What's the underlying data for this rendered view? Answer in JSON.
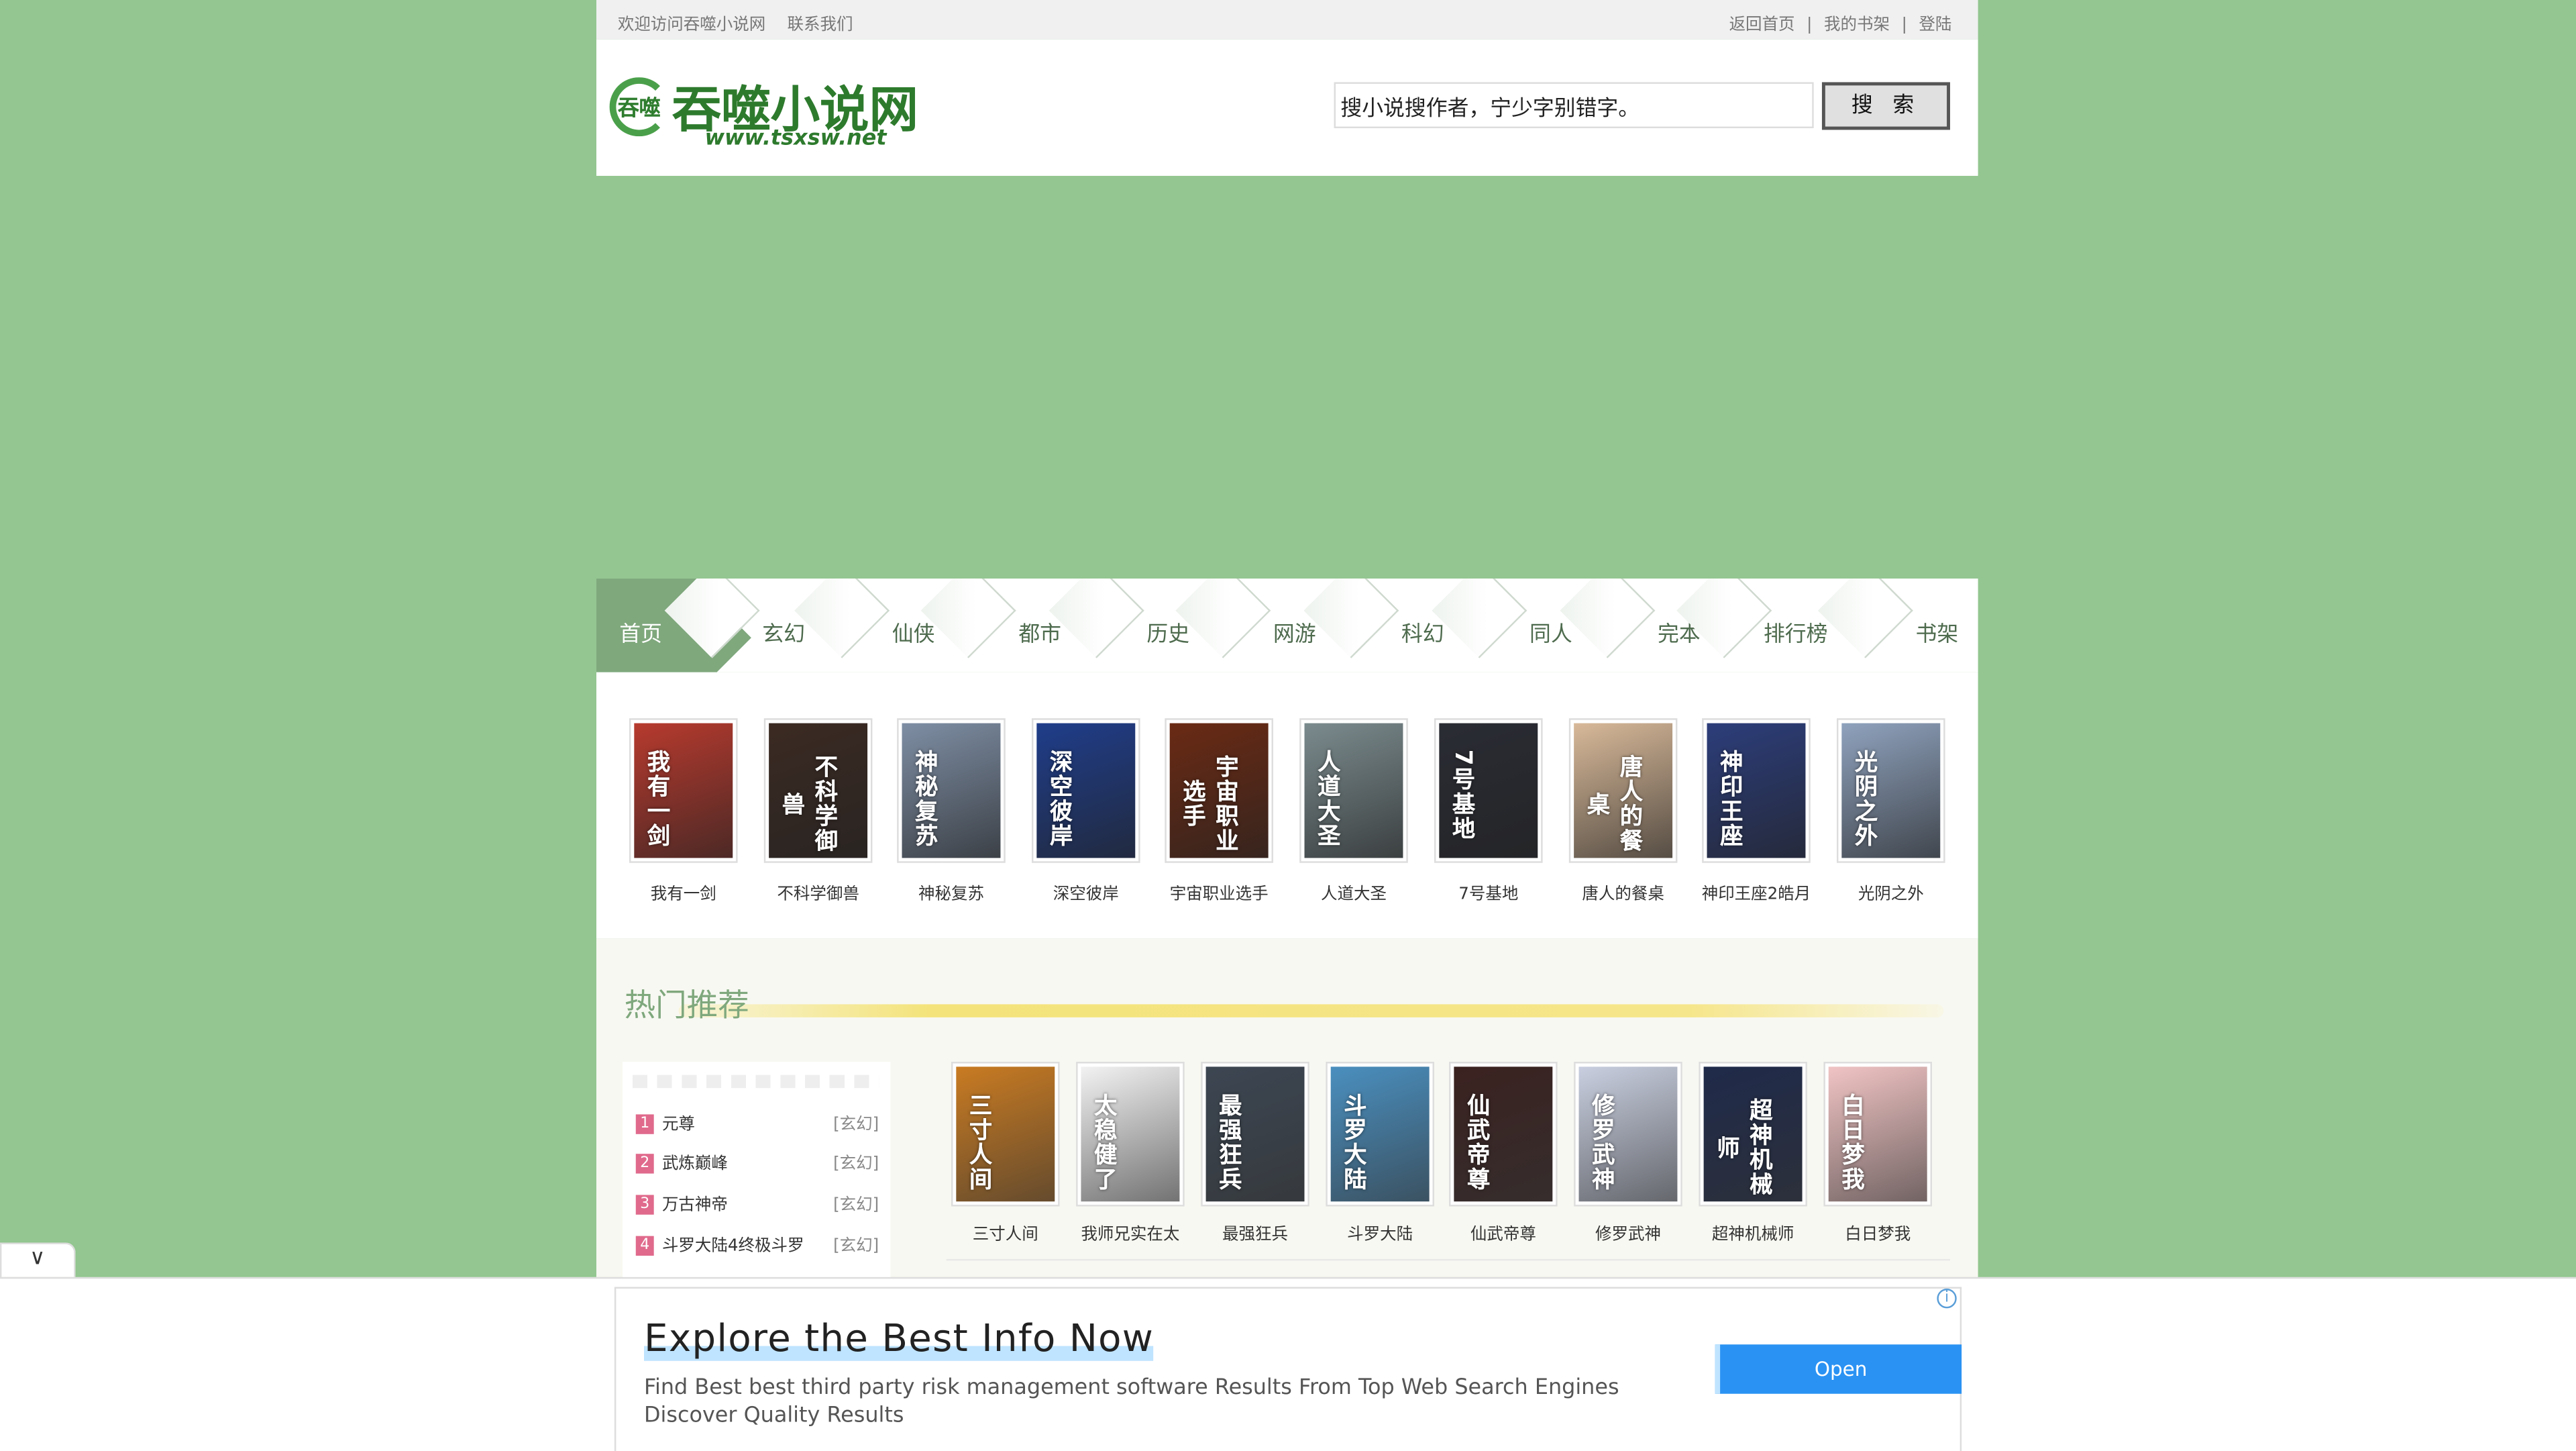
{
  "topbar": {
    "welcome": "欢迎访问吞噬小说网",
    "contact": "联系我们",
    "back_home": "返回首页",
    "my_shelf": "我的书架",
    "login": "登陆",
    "sep": "|"
  },
  "header": {
    "logo_badge": "吞噬",
    "logo_title": "吞噬小说网",
    "logo_url": "www.tsxsw.net",
    "search_placeholder": "搜小说搜作者，宁少字别错字。",
    "search_button": "搜 索"
  },
  "nav": {
    "items": [
      "首页",
      "玄幻",
      "仙侠",
      "都市",
      "历史",
      "网游",
      "科幻",
      "同人",
      "完本",
      "排行榜",
      "书架"
    ]
  },
  "featured": {
    "books": [
      {
        "title": "我有一剑",
        "cover_text": "我有一剑",
        "color": "#b73a2e"
      },
      {
        "title": "不科学御兽",
        "cover_text": "不科学御兽",
        "color": "#3b2a22"
      },
      {
        "title": "神秘复苏",
        "cover_text": "神秘复苏",
        "color": "#7e8ea4"
      },
      {
        "title": "深空彼岸",
        "cover_text": "深空彼岸",
        "color": "#1f3d8a"
      },
      {
        "title": "宇宙职业选手",
        "cover_text": "宇宙职业选手",
        "color": "#6a2a14"
      },
      {
        "title": "人道大圣",
        "cover_text": "人道大圣",
        "color": "#7b8b8e"
      },
      {
        "title": "7号基地",
        "cover_text": "7号基地",
        "color": "#2a2c34"
      },
      {
        "title": "唐人的餐桌",
        "cover_text": "唐人的餐桌",
        "color": "#d8b999"
      },
      {
        "title": "神印王座2皓月",
        "cover_text": "神印王座",
        "color": "#2c3d7a"
      },
      {
        "title": "光阴之外",
        "cover_text": "光阴之外",
        "color": "#8fa2bd"
      }
    ]
  },
  "hot": {
    "title": "热门推荐",
    "ranking": [
      {
        "num": "1",
        "title": "元尊",
        "cat": "[玄幻]"
      },
      {
        "num": "2",
        "title": "武炼巅峰",
        "cat": "[玄幻]"
      },
      {
        "num": "3",
        "title": "万古神帝",
        "cat": "[玄幻]"
      },
      {
        "num": "4",
        "title": "斗罗大陆4终极斗罗",
        "cat": "[玄幻]"
      }
    ],
    "recommend": [
      {
        "title": "三寸人间",
        "cover_text": "三寸人间",
        "color": "#c97b22"
      },
      {
        "title": "我师兄实在太",
        "cover_text": "太稳健了",
        "color": "#f2f2f2"
      },
      {
        "title": "最强狂兵",
        "cover_text": "最强狂兵",
        "color": "#3c4652"
      },
      {
        "title": "斗罗大陆",
        "cover_text": "斗罗大陆",
        "color": "#4a8fbf"
      },
      {
        "title": "仙武帝尊",
        "cover_text": "仙武帝尊",
        "color": "#3a2220"
      },
      {
        "title": "修罗武神",
        "cover_text": "修罗武神",
        "color": "#c9cfe0"
      },
      {
        "title": "超神机械师",
        "cover_text": "超神机械师",
        "color": "#1f2a4a"
      },
      {
        "title": "白日梦我",
        "cover_text": "白日梦我",
        "color": "#f1c4c4"
      }
    ]
  },
  "ad": {
    "title": "Explore the Best Info Now",
    "description": "Find Best best third party risk management software Results From Top Web Search Engines Discover Quality Results",
    "open_label": "Open",
    "info_icon": "i"
  },
  "collapse_icon": "chevron-down-icon"
}
